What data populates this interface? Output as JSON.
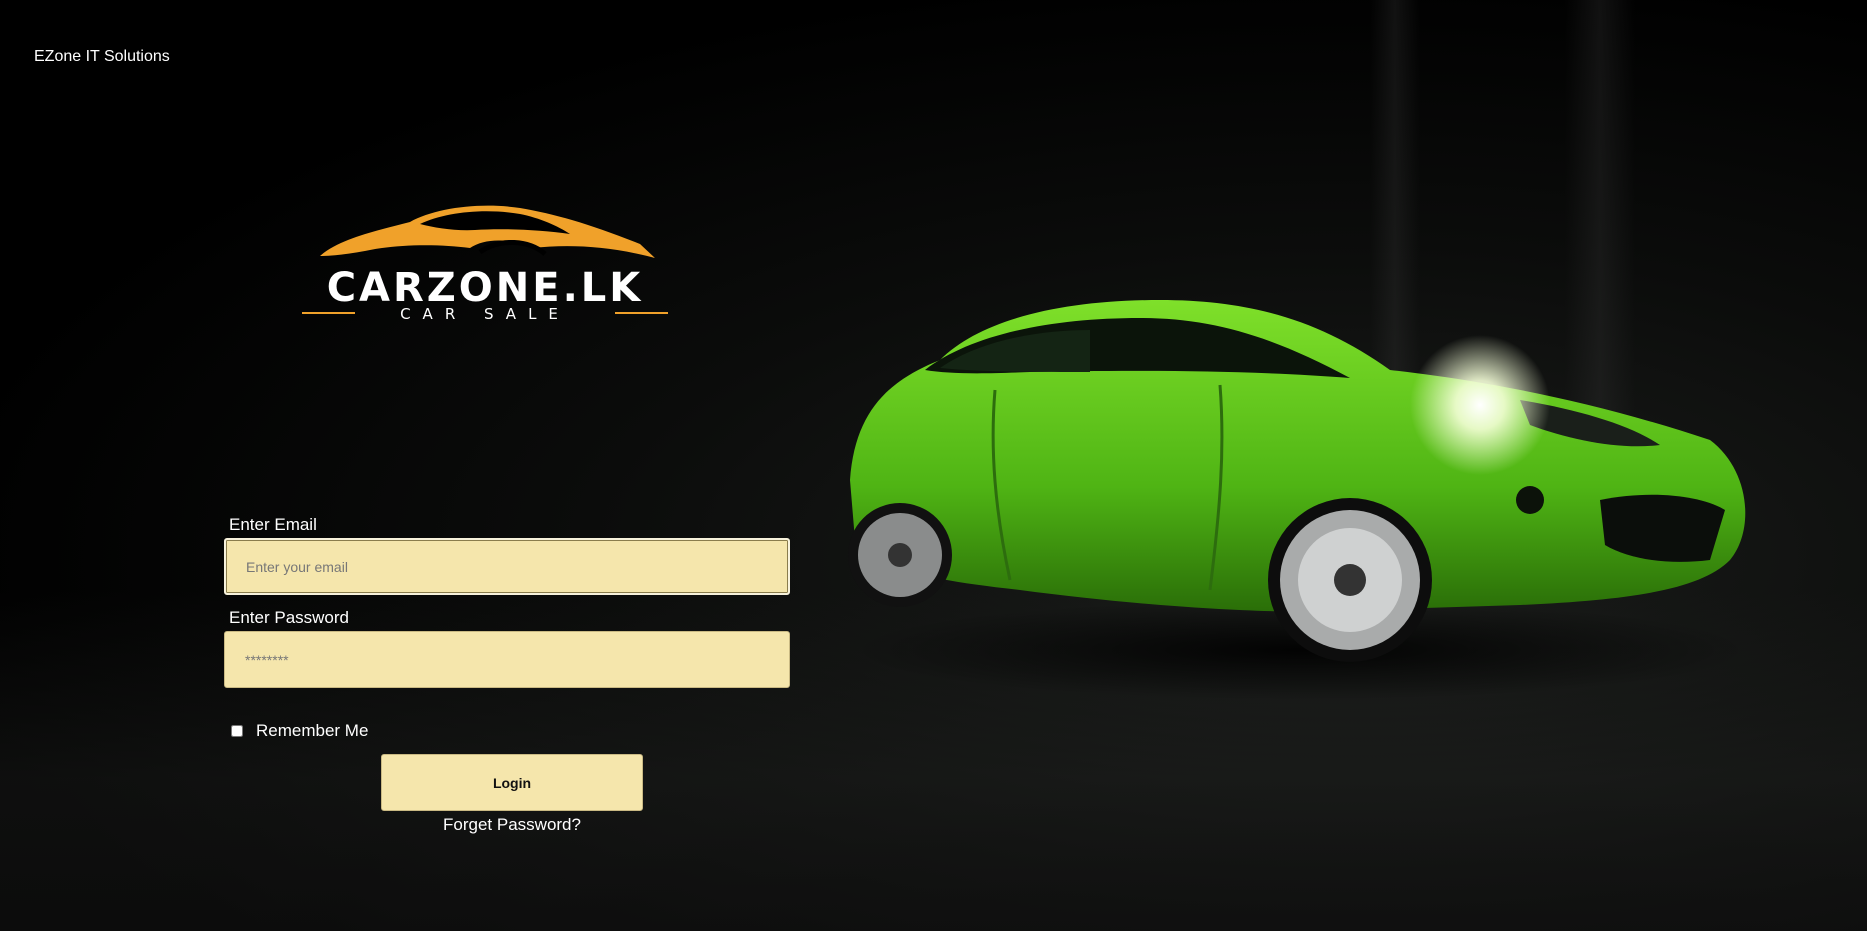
{
  "company": {
    "name": "EZone IT Solutions"
  },
  "logo": {
    "brand": "CARZONE.LK",
    "tagline": "CAR SALE",
    "accent_color": "#f0a12a"
  },
  "form": {
    "email_label": "Enter Email",
    "email_placeholder": "Enter your email",
    "email_value": "",
    "password_label": "Enter Password",
    "password_placeholder": "********",
    "password_value": "",
    "remember_label": "Remember Me",
    "remember_checked": false,
    "login_label": "Login",
    "forgot_label": "Forget Password?",
    "field_color": "#f5e6ac"
  }
}
